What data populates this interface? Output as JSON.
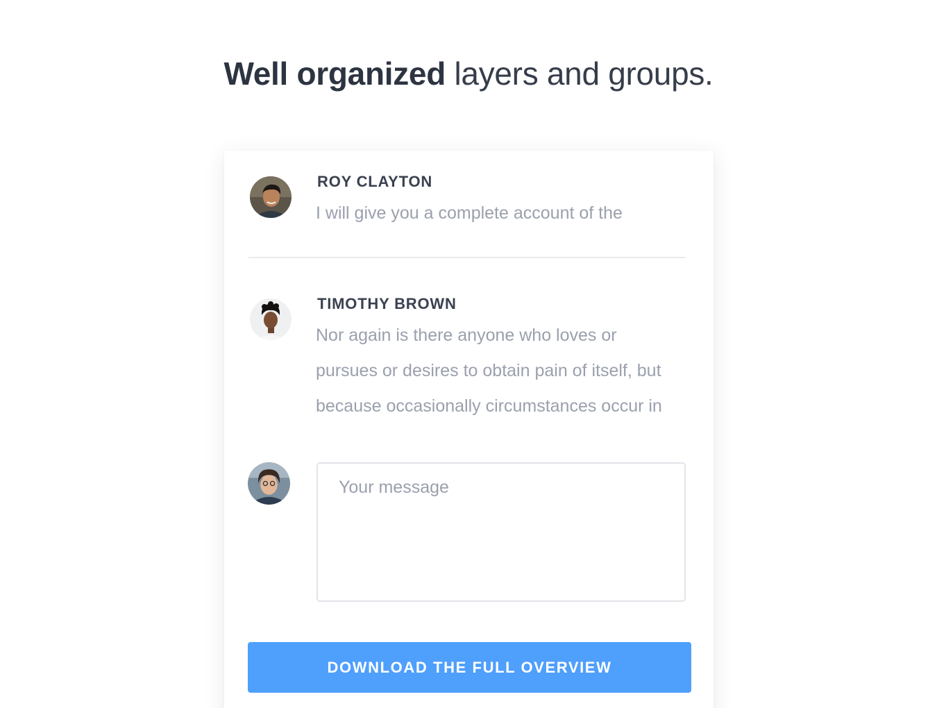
{
  "heading": {
    "bold": "Well organized",
    "rest": " layers and groups."
  },
  "comments": [
    {
      "name": "ROY CLAYTON",
      "lines": [
        "I will give you a complete account of the"
      ]
    },
    {
      "name": "TIMOTHY BROWN",
      "lines": [
        "Nor again is there anyone who loves or",
        "pursues or desires to obtain pain of itself, but",
        "because occasionally circumstances occur in"
      ]
    }
  ],
  "reply": {
    "placeholder": "Your message"
  },
  "cta": {
    "label": "DOWNLOAD THE FULL OVERVIEW",
    "color": "#4f9ffd"
  }
}
